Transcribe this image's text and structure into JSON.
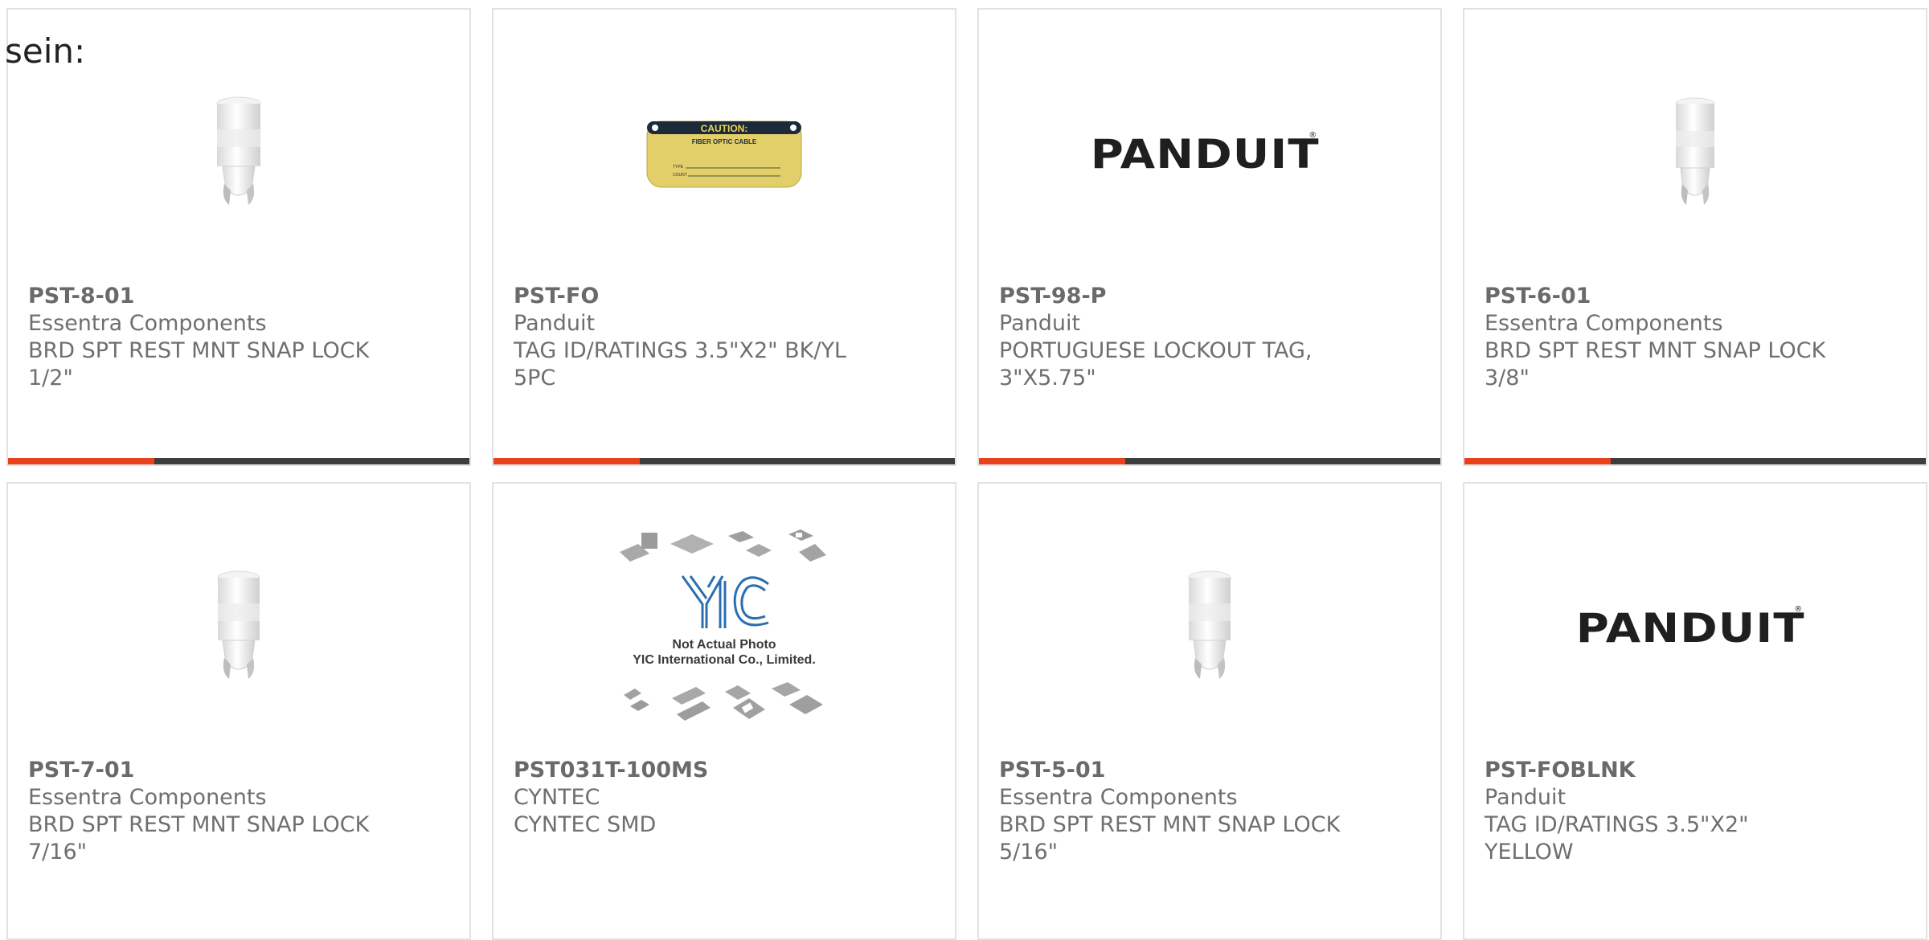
{
  "intro_text": "sein:",
  "colors": {
    "accent_bar": "#e8411c",
    "bar_dark": "#3d3d3d",
    "card_border": "#e2e2e2",
    "text_gray": "#6f6f6f"
  },
  "products": [
    {
      "part_number": "PST-8-01",
      "manufacturer": "Essentra Components",
      "description": "BRD SPT REST MNT SNAP LOCK 1/2\"",
      "image": "white-snap-lock-support-icon"
    },
    {
      "part_number": "PST-FO",
      "manufacturer": "Panduit",
      "description": "TAG ID/RATINGS 3.5\"X2\" BK/YL 5PC",
      "image": "fiber-optic-caution-tag-image",
      "tag_text": {
        "header": "CAUTION:",
        "line1": "FIBER OPTIC CABLE",
        "line2": "TYPE",
        "line3": "COUNT"
      }
    },
    {
      "part_number": "PST-98-P",
      "manufacturer": "Panduit",
      "description": "PORTUGUESE LOCKOUT TAG, 3\"X5.75\"",
      "image": "panduit-logo",
      "logo_text": "PANDUIT"
    },
    {
      "part_number": "PST-6-01",
      "manufacturer": "Essentra Components",
      "description": "BRD SPT REST MNT SNAP LOCK 3/8\"",
      "image": "white-snap-lock-support-icon"
    },
    {
      "part_number": "PST-7-01",
      "manufacturer": "Essentra Components",
      "description": "BRD SPT REST MNT SNAP LOCK 7/16\"",
      "image": "white-snap-lock-support-icon"
    },
    {
      "part_number": "PST031T-100MS",
      "manufacturer": "CYNTEC",
      "description": "CYNTEC SMD",
      "image": "not-actual-photo-placeholder",
      "placeholder_text": {
        "line1": "Not Actual Photo",
        "line2": "YIC International Co., Limited."
      }
    },
    {
      "part_number": "PST-5-01",
      "manufacturer": "Essentra Components",
      "description": "BRD SPT REST MNT SNAP LOCK 5/16\"",
      "image": "white-snap-lock-support-icon"
    },
    {
      "part_number": "PST-FOBLNK",
      "manufacturer": "Panduit",
      "description": "TAG ID/RATINGS 3.5\"X2\" YELLOW",
      "image": "panduit-logo",
      "logo_text": "PANDUIT"
    }
  ]
}
